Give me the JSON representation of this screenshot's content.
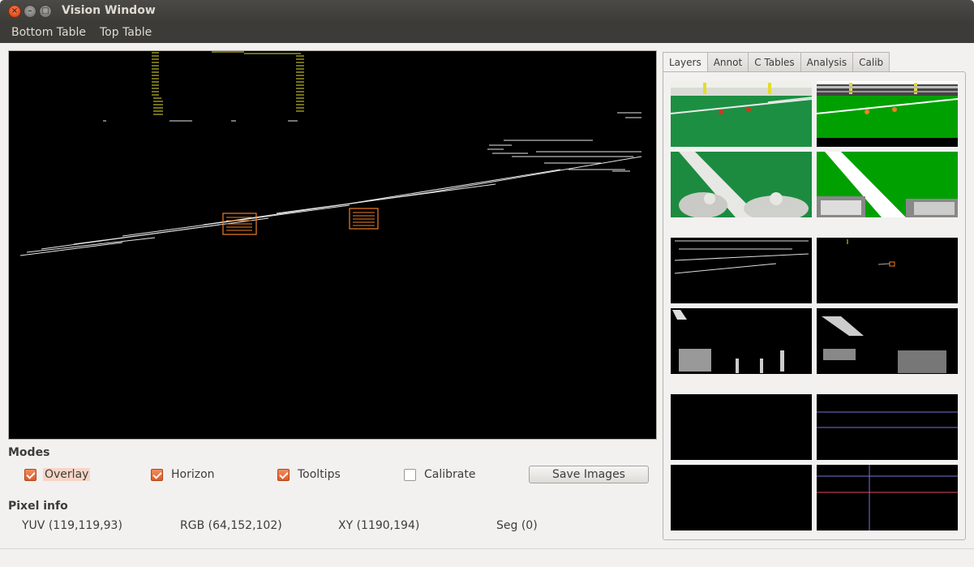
{
  "window": {
    "title": "Vision Window"
  },
  "menu": {
    "items": [
      "Bottom Table",
      "Top Table"
    ]
  },
  "modes": {
    "title": "Modes",
    "options": [
      {
        "label": "Overlay",
        "checked": true
      },
      {
        "label": "Horizon",
        "checked": true
      },
      {
        "label": "Tooltips",
        "checked": true
      },
      {
        "label": "Calibrate",
        "checked": false
      }
    ],
    "save_label": "Save Images"
  },
  "pixel_info": {
    "title": "Pixel info",
    "yuv": "YUV (119,119,93)",
    "rgb": "RGB (64,152,102)",
    "xy": "XY (1190,194)",
    "seg": "Seg (0)"
  },
  "tabs": [
    "Layers",
    "Annot",
    "C Tables",
    "Analysis",
    "Calib"
  ],
  "active_tab": "Layers",
  "colors": {
    "accent": "#e0622a",
    "field_green": "#1b8a3c",
    "seg_green": "#00a000",
    "ball": "#f07f24",
    "goal_yellow": "#e3dc2a"
  }
}
